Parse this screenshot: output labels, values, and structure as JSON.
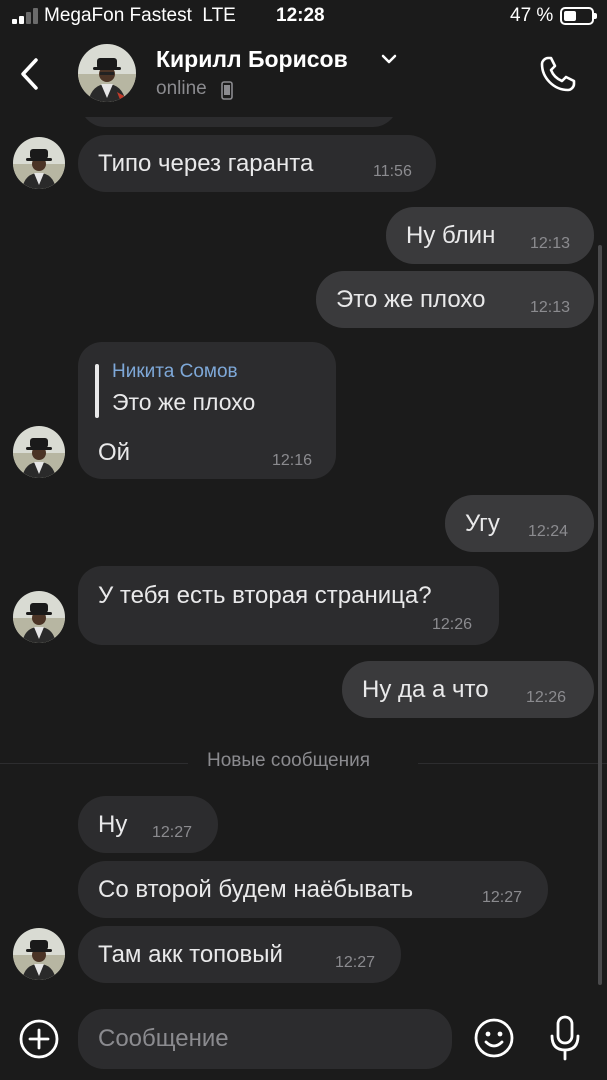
{
  "status_bar": {
    "carrier": "MegaFon Fastest",
    "network": "LTE",
    "time": "12:28",
    "battery_percent_text": "47 %",
    "battery_level": 0.47
  },
  "header": {
    "name": "Кирилл Борисов",
    "status": "online"
  },
  "messages": [
    {
      "direction": "in",
      "text": "Типо через гаранта",
      "time": "11:56"
    },
    {
      "direction": "out",
      "text": "Ну блин",
      "time": "12:13"
    },
    {
      "direction": "out",
      "text": "Это же плохо",
      "time": "12:13"
    },
    {
      "direction": "in",
      "reply_author": "Никита Сомов",
      "reply_text": "Это же плохо",
      "text": "Ой",
      "time": "12:16"
    },
    {
      "direction": "out",
      "text": "Угу",
      "time": "12:24"
    },
    {
      "direction": "in",
      "text": "У тебя есть вторая страница?",
      "time": "12:26"
    },
    {
      "direction": "out",
      "text": "Ну да а что",
      "time": "12:26"
    },
    {
      "direction": "in",
      "text": "Ну",
      "time": "12:27"
    },
    {
      "direction": "in",
      "text": "Со второй будем наёбывать",
      "time": "12:27"
    },
    {
      "direction": "in",
      "text": "Там акк топовый",
      "time": "12:27"
    }
  ],
  "divider": {
    "label": "Новые сообщения"
  },
  "composer": {
    "placeholder": "Сообщение"
  },
  "icons": {
    "back": "chevron-left-icon",
    "phone": "phone-icon",
    "add": "plus-circle-icon",
    "emoji": "smiley-icon",
    "mic": "microphone-icon"
  },
  "colors": {
    "background": "#1b1b1b",
    "incoming_bubble": "#2c2c2e",
    "outgoing_bubble": "#3a3a3c",
    "reply_author": "#7ea8d8",
    "secondary_text": "#8b8b8f"
  }
}
